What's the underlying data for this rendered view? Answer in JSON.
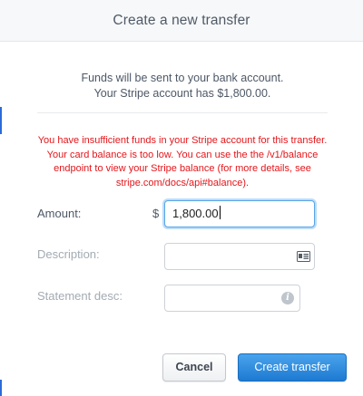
{
  "header": {
    "title": "Create a new transfer"
  },
  "info": {
    "line1": "Funds will be sent to your bank account.",
    "line2": "Your Stripe account has $1,800.00."
  },
  "error": {
    "message": "You have insufficient funds in your Stripe account for this transfer. Your card balance is too low. You can use the the /v1/balance endpoint to view your Stripe balance (for more details, see stripe.com/docs/api#balance)."
  },
  "form": {
    "amount": {
      "label": "Amount:",
      "currency_symbol": "$",
      "value": "1,800.00"
    },
    "description": {
      "label": "Description:",
      "value": "",
      "icon": "id-card-icon"
    },
    "statement_desc": {
      "label": "Statement desc:",
      "value": "",
      "icon": "info-icon"
    }
  },
  "buttons": {
    "cancel": "Cancel",
    "create": "Create transfer"
  },
  "colors": {
    "error": "#e5151a",
    "primary": "#1d7ad1",
    "focus_ring": "#57a4e8"
  }
}
